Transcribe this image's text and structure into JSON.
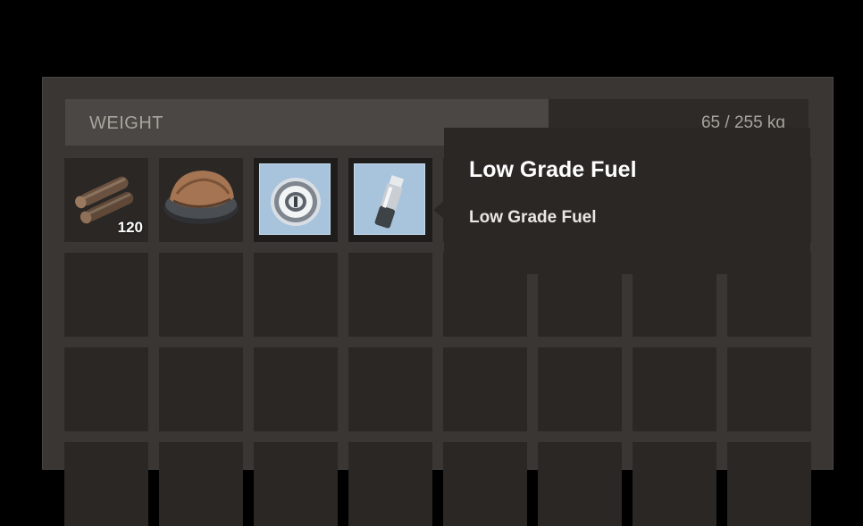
{
  "inventory": {
    "weight_label": "WEIGHT",
    "weight_value": "65 / 255 kg",
    "weight_fraction": 0.65,
    "slots": [
      {
        "item": "wood-logs",
        "quantity": "120"
      },
      {
        "item": "leather-hat",
        "quantity": ""
      },
      {
        "item": "metal-valve",
        "quantity": "",
        "selected": true
      },
      {
        "item": "low-grade-fuel",
        "quantity": "",
        "selected": true
      }
    ]
  },
  "tooltip": {
    "title": "Low Grade Fuel",
    "description": "Low Grade Fuel"
  },
  "colors": {
    "panel": "#3a3633",
    "slot": "#2a2725",
    "selected_slot_bg": "#a8c3dc",
    "tooltip_bg": "#2b2725",
    "weight_text": "#a9a39d"
  }
}
